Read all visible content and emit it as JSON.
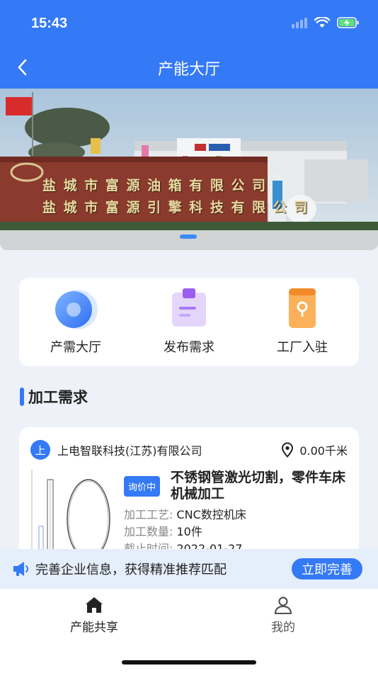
{
  "status_bar": {
    "time": "15:43"
  },
  "header": {
    "title": "产能大厅"
  },
  "banner": {
    "sign_line1": "盐 城 市 富 源 油 箱 有 限 公 司",
    "sign_line2": "盐 城 市 富 源 引 擎 科 技 有 限 公 司"
  },
  "menu": [
    {
      "label": "产需大厅",
      "icon": "capacity-hall-icon"
    },
    {
      "label": "发布需求",
      "icon": "publish-demand-icon"
    },
    {
      "label": "工厂入驻",
      "icon": "factory-join-icon"
    }
  ],
  "section": {
    "title": "加工需求"
  },
  "job": {
    "badge": "上",
    "company": "上电智联科技(江苏)有限公司",
    "distance": "0.00千米",
    "tag": "询价中",
    "title": "不锈钢管激光切割，零件车床机械加工",
    "process_label": "加工工艺:",
    "process_value": "CNC数控机床",
    "quantity_label": "加工数量:",
    "quantity_value": "10件",
    "deadline_label": "截止时间:",
    "deadline_value": "2022-01-27"
  },
  "notice": {
    "text": "完善企业信息，获得精准推荐匹配",
    "button": "立即完善"
  },
  "tabbar": [
    {
      "label": "产能共享",
      "active": true
    },
    {
      "label": "我的",
      "active": false
    }
  ],
  "colors": {
    "primary": "#3479f6",
    "notice_bg": "#e5eefb",
    "page_bg": "#eef1f7"
  }
}
